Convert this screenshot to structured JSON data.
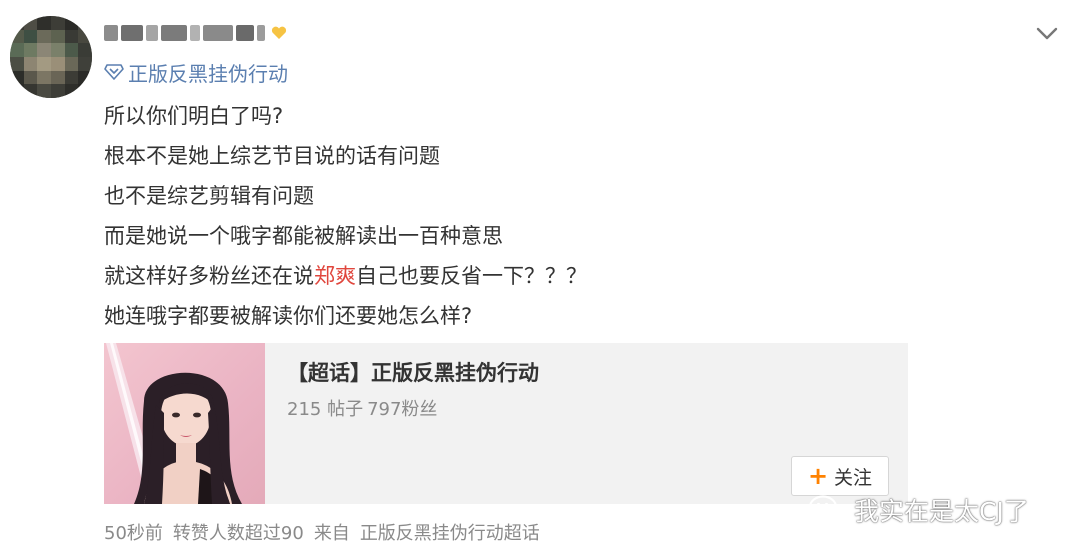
{
  "post": {
    "username_obscured": true,
    "source_label": "正版反黑挂伪行动",
    "lines": [
      "所以你们明白了吗?",
      "根本不是她上综艺节目说的话有问题",
      "也不是综艺剪辑有问题",
      "而是她说一个哦字都能被解读出一百种意思"
    ],
    "line5": {
      "before": "就这样好多粉丝还在说",
      "highlight": "郑爽",
      "after": "自己也要反省一下？？？"
    },
    "line6": "她连哦字都要被解读你们还要她怎么样?"
  },
  "card": {
    "title": "【超话】正版反黑挂伪行动",
    "posts": "215 帖子",
    "fans": "797粉丝",
    "follow_label": "关注"
  },
  "footer": {
    "time": "50秒前",
    "reposts": "转赞人数超过90",
    "from_prefix": "来自",
    "from_source": "正版反黑挂伪行动超话"
  },
  "watermark": {
    "text": "我实在是太CJ了"
  },
  "colors": {
    "link": "#5b7fb0",
    "highlight": "#e0463d",
    "follow_plus": "#ff8200",
    "card_bg": "#f2f2f2"
  },
  "icons": {
    "source": "location-diamond-icon",
    "menu": "chevron-down-icon",
    "watermark": "wechat-icon"
  }
}
